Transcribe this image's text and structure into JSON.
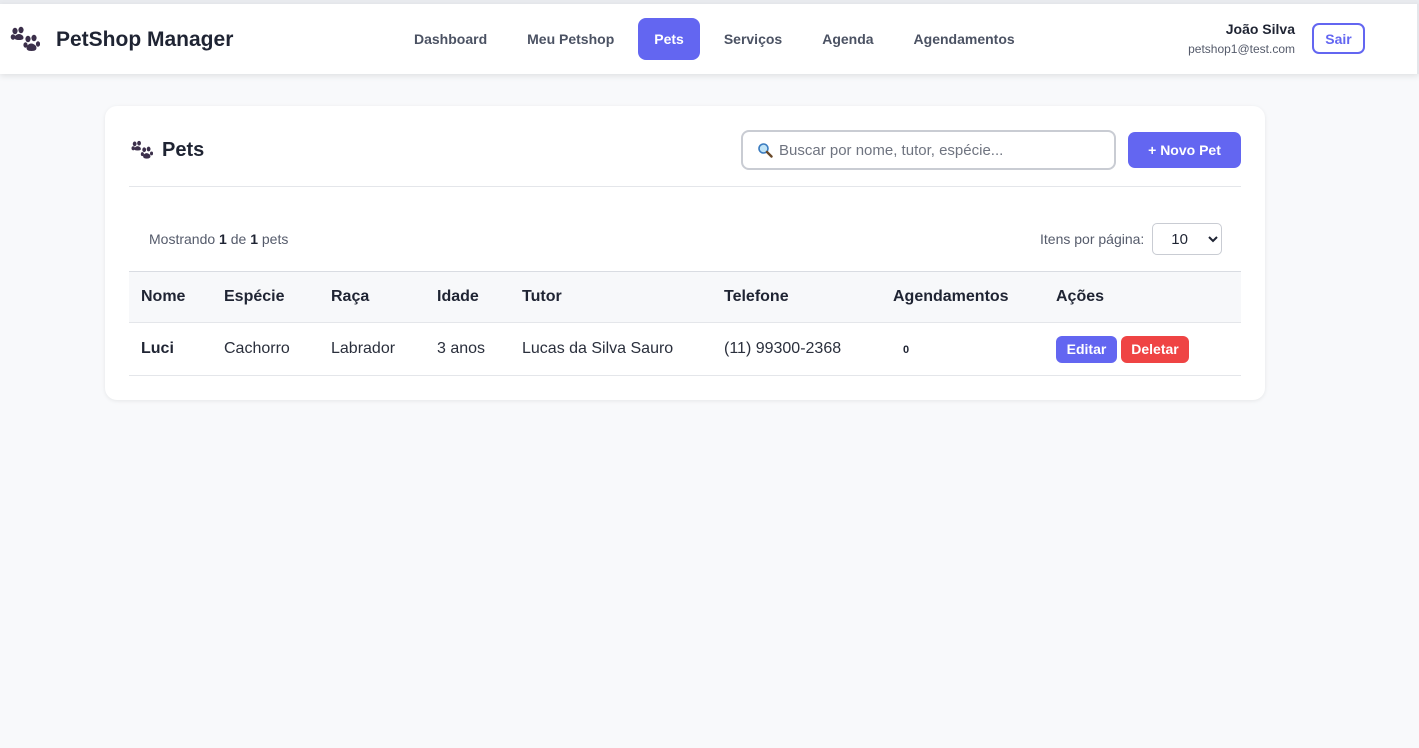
{
  "navbar": {
    "brand": "PetShop Manager",
    "brand_icon": "paw-icon",
    "items": [
      {
        "label": "Dashboard",
        "active": false
      },
      {
        "label": "Meu Petshop",
        "active": false
      },
      {
        "label": "Pets",
        "active": true
      },
      {
        "label": "Serviços",
        "active": false
      },
      {
        "label": "Agenda",
        "active": false
      },
      {
        "label": "Agendamentos",
        "active": false
      }
    ],
    "user": {
      "name": "João Silva",
      "email": "petshop1@test.com"
    },
    "logout_label": "Sair"
  },
  "page": {
    "title": "Pets",
    "title_icon": "paw-icon",
    "search": {
      "placeholder": "Buscar por nome, tutor, espécie...",
      "value": "",
      "icon": "search-icon"
    },
    "new_button": "+ Novo Pet",
    "showing": {
      "prefix": "Mostrando",
      "shown": "1",
      "of": "de",
      "total": "1",
      "suffix": "pets"
    },
    "per_page": {
      "label": "Itens por página:",
      "selected": "10"
    }
  },
  "table": {
    "columns": [
      "Nome",
      "Espécie",
      "Raça",
      "Idade",
      "Tutor",
      "Telefone",
      "Agendamentos",
      "Ações"
    ],
    "rows": [
      {
        "nome": "Luci",
        "especie": "Cachorro",
        "raca": "Labrador",
        "idade": "3 anos",
        "tutor": "Lucas da Silva Sauro",
        "telefone": "(11) 99300-2368",
        "agendamentos": "0",
        "edit_label": "Editar",
        "delete_label": "Deletar"
      }
    ]
  },
  "colors": {
    "primary": "#6366f1",
    "danger": "#ef4444",
    "background": "#f8f9fb"
  }
}
